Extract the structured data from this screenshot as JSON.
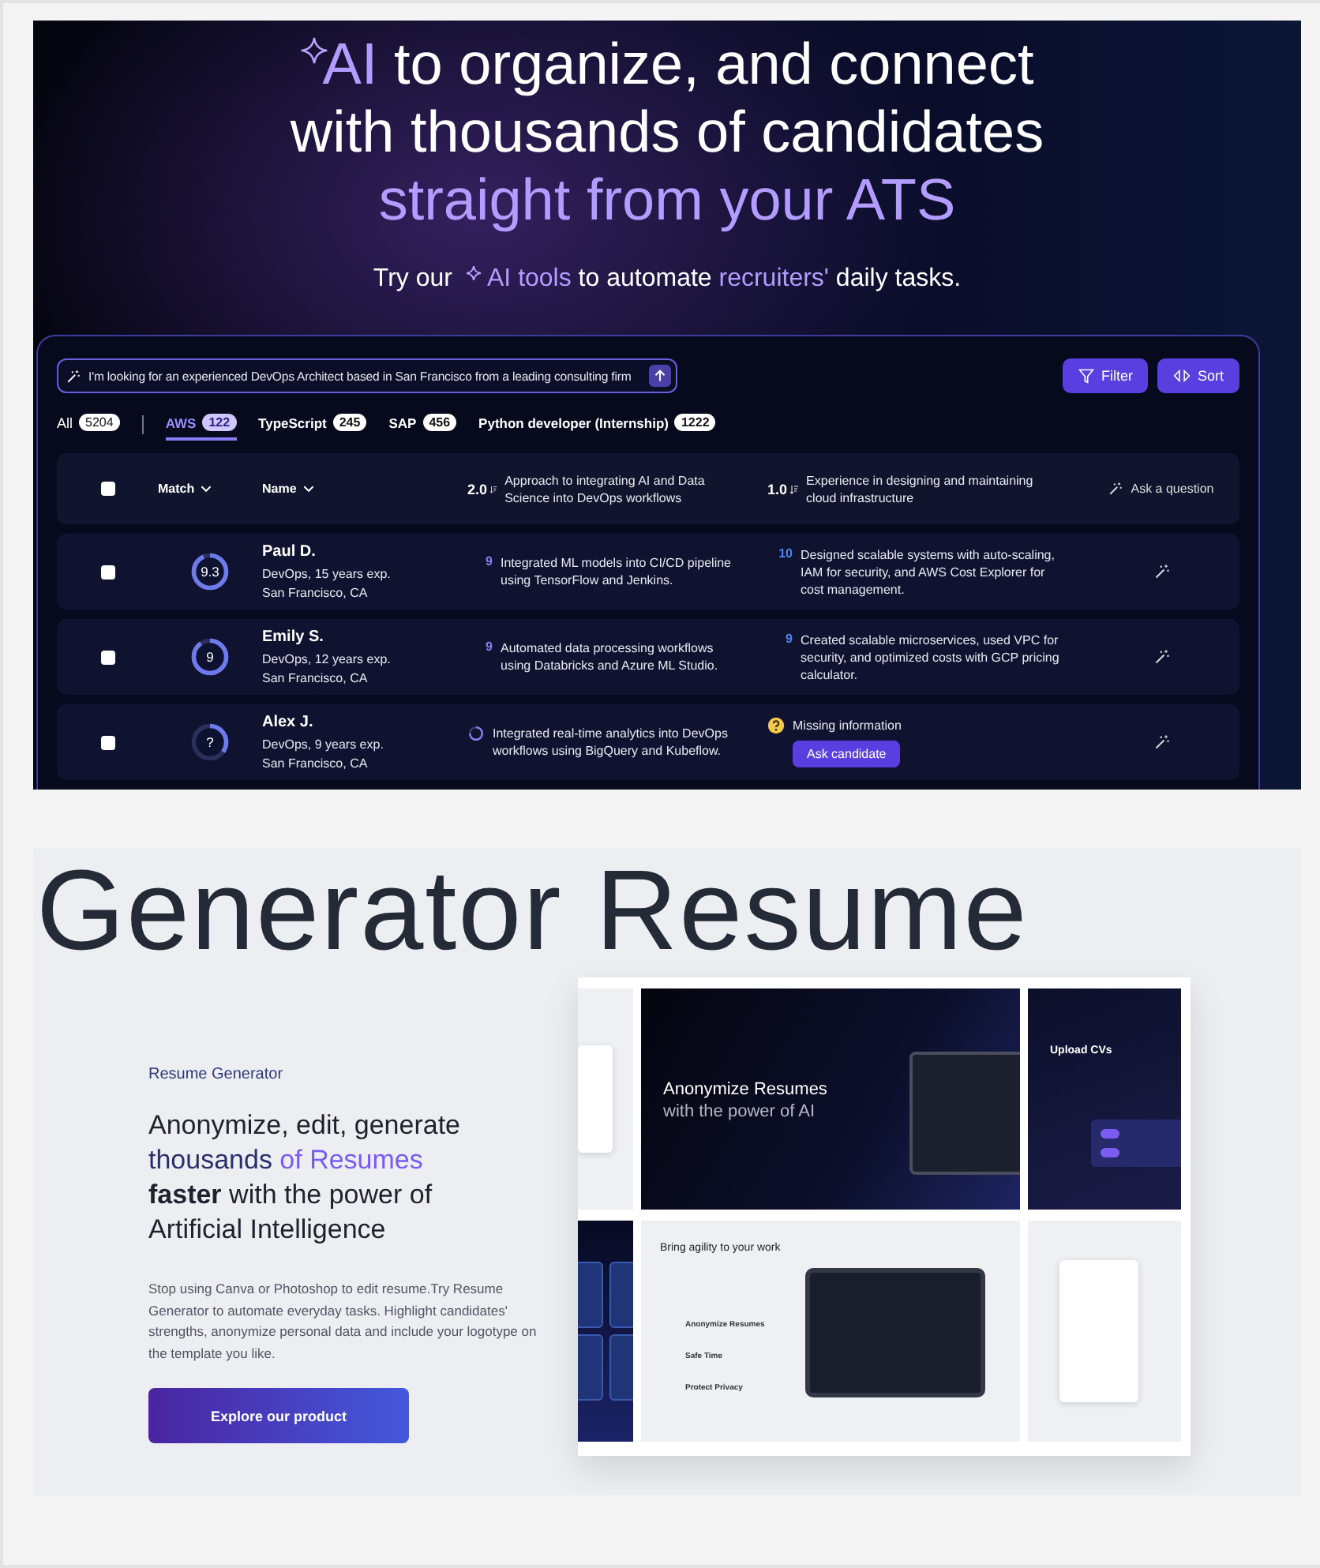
{
  "hero": {
    "headline": [
      [
        {
          "text": "AI",
          "accent": true
        },
        {
          "text": " to organize, and connect",
          "accent": false
        }
      ],
      [
        {
          "text": "with thousands of candidates",
          "accent": false
        }
      ],
      [
        {
          "text": "straight from your ATS",
          "accent": true
        }
      ]
    ],
    "subtitle": {
      "lead": "Try our",
      "rest": [
        {
          "text": "AI tools",
          "accent": true
        },
        {
          "text": " to automate ",
          "accent": false
        },
        {
          "text": "recruiters'",
          "accent": true
        },
        {
          "text": " daily tasks.",
          "accent": false
        }
      ]
    }
  },
  "search": {
    "value": "I'm looking for an experienced DevOps Architect based in San Francisco from a leading consulting firm"
  },
  "buttons": [
    "Filter",
    "Sort"
  ],
  "tabs": [
    {
      "label": "All",
      "count": "5204",
      "selected": false
    },
    {
      "label": "AWS",
      "count": "122",
      "selected": true
    },
    {
      "label": "TypeScript",
      "count": "245",
      "selected": false
    },
    {
      "label": "SAP",
      "count": "456",
      "selected": false
    },
    {
      "label": "Python developer (Internship)",
      "count": "1222",
      "selected": false
    }
  ],
  "table": {
    "header": {
      "checked": false,
      "match": "Match",
      "name": "Name",
      "criteria": [
        {
          "weight": "2.0",
          "text": "Approach to integrating AI and Data Science into DevOps workflows"
        },
        {
          "weight": "1.0",
          "text": "Experience in designing and maintaining cloud infrastructure"
        }
      ],
      "ask": "Ask a question"
    },
    "rows": [
      {
        "checked": false,
        "match": {
          "score": "9.3",
          "level": 0.93
        },
        "name": "Paul D.",
        "role": "DevOps, 15 years exp.",
        "location": "San Francisco, CA",
        "criteria": [
          {
            "kind": "score",
            "score": "9",
            "text": "Integrated ML models into CI/CD pipeline using TensorFlow and Jenkins."
          },
          {
            "kind": "score",
            "score": "10",
            "text": "Designed scalable systems with auto-scaling, IAM for security, and AWS Cost Explorer for cost management."
          }
        ]
      },
      {
        "checked": false,
        "match": {
          "score": "9",
          "level": 0.9
        },
        "name": "Emily S.",
        "role": "DevOps, 12 years exp.",
        "location": "San Francisco, CA",
        "criteria": [
          {
            "kind": "score",
            "score": "9",
            "text": "Automated data processing workflows using Databricks and Azure ML Studio."
          },
          {
            "kind": "score",
            "score": "9",
            "text": "Created scalable microservices, used VPC for security, and optimized costs with GCP pricing calculator."
          }
        ]
      },
      {
        "checked": false,
        "match": {
          "score": "?",
          "level": 0.35
        },
        "name": "Alex J.",
        "role": "DevOps, 9 years exp.",
        "location": "San Francisco, CA",
        "criteria": [
          {
            "kind": "loading",
            "text": "Integrated real-time analytics into DevOps workflows using BigQuery and Kubeflow."
          },
          {
            "kind": "missing",
            "text": "Missing information",
            "action": "Ask candidate"
          }
        ]
      }
    ]
  },
  "showcase": {
    "marquee": "Generator Resume",
    "eyebrow": "Resume Generator",
    "headline": [
      [
        {
          "text": "Anonymize, edit, generate",
          "accent": false,
          "bold": false
        }
      ],
      [
        {
          "text": "thousands",
          "accent": false,
          "bold": false
        },
        {
          "text": " of Resumes",
          "accent": true,
          "bold": false
        }
      ],
      [
        {
          "text": "faster",
          "accent": false,
          "bold": true
        },
        {
          "text": " with the power of",
          "accent": false,
          "bold": false
        }
      ],
      [
        {
          "text": "Artificial Intelligence",
          "accent": false,
          "bold": false
        }
      ]
    ],
    "body": "Stop using Canva or Photoshop to edit resume.Try Resume Generator to automate everyday tasks. Highlight candidates' strengths, anonymize personal data and include your logotype on the template you like.",
    "cta": "Explore our product",
    "preview": {
      "hero_title": "Anonymize Resumes",
      "hero_subtitle": "with the power of AI",
      "upload_title": "Upload CVs",
      "toggles": [
        {
          "on": true
        },
        {
          "on": true
        }
      ],
      "agility_title": "Bring agility to your work",
      "features": [
        "Anonymize Resumes",
        "Safe Time",
        "Protect Privacy"
      ]
    }
  }
}
